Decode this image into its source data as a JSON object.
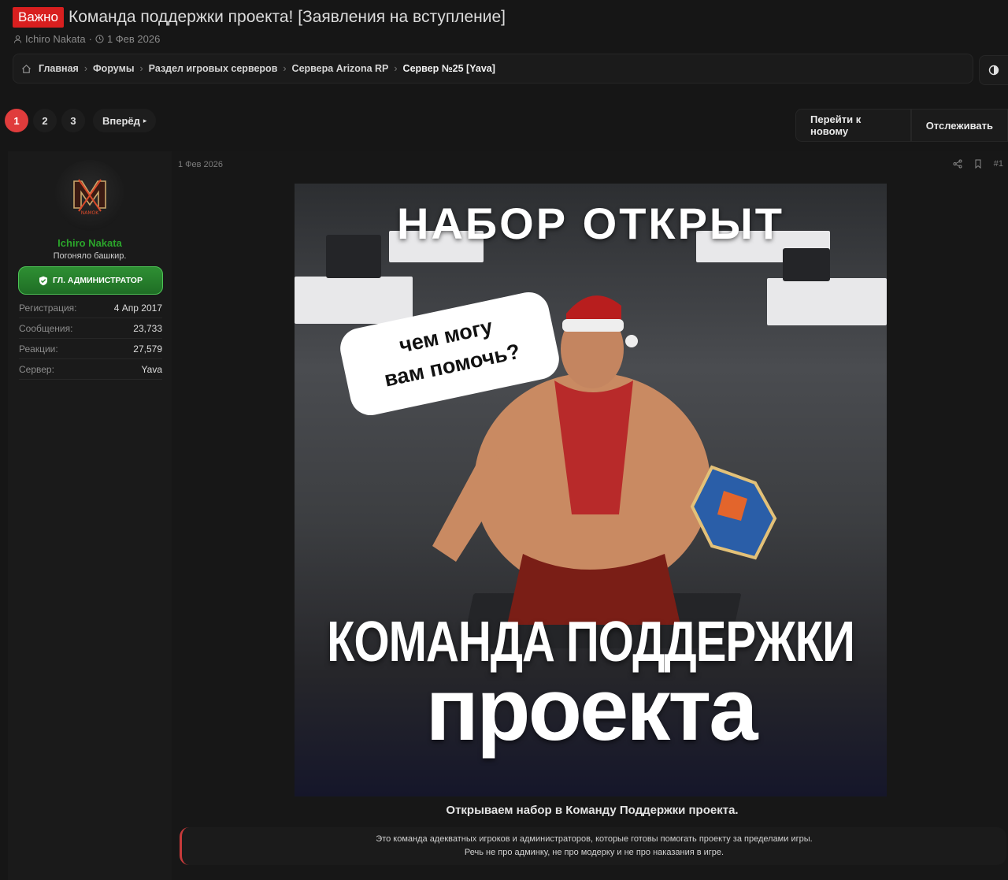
{
  "thread": {
    "badge": "Важно",
    "title": "Команда поддержки проекта! [Заявления на вступление]",
    "author": "Ichiro Nakata",
    "date": "1 Фев 2026",
    "meta_sep": "·"
  },
  "breadcrumb": [
    {
      "label": "Главная"
    },
    {
      "label": "Форумы"
    },
    {
      "label": "Раздел игровых серверов"
    },
    {
      "label": "Сервера Arizona RP"
    },
    {
      "label": "Сервер №25 [Yava]"
    }
  ],
  "pagination": {
    "pages": [
      "1",
      "2",
      "3"
    ],
    "active": "1",
    "next_label": "Вперёд"
  },
  "actions": {
    "jump_new": "Перейти к новому",
    "watch": "Отслеживать"
  },
  "user": {
    "name": "Ichiro Nakata",
    "title": "Погоняло башкир.",
    "role": "ГЛ. АДМИНИСТРАТОР",
    "avatar_text": "NAMOK",
    "stats": [
      {
        "key": "Регистрация:",
        "value": "4 Апр 2017"
      },
      {
        "key": "Сообщения:",
        "value": "23,733"
      },
      {
        "key": "Реакции:",
        "value": "27,579"
      },
      {
        "key": "Сервер:",
        "value": "Yava"
      }
    ]
  },
  "post": {
    "date": "1 Фев 2026",
    "number": "#1",
    "banner": {
      "top_text": "НАБОР ОТКРЫТ",
      "bubble_line1": "чем могу",
      "bubble_line2": "вам помочь?",
      "mid_text": "КОМАНДА ПОДДЕРЖКИ",
      "big_text": "проекта"
    },
    "heading": "Открываем набор в Команду Поддержки проекта.",
    "quote_line1": "Это команда адекватных игроков и администраторов, которые готовы помогать проекту за пределами игры.",
    "quote_line2": "Речь не про админку, не про модерку и не про наказания в игре."
  },
  "colors": {
    "accent_red": "#e03c3c",
    "badge_red": "#d81f1f",
    "username_green": "#2ba52b",
    "role_green": "#2e8f33"
  }
}
